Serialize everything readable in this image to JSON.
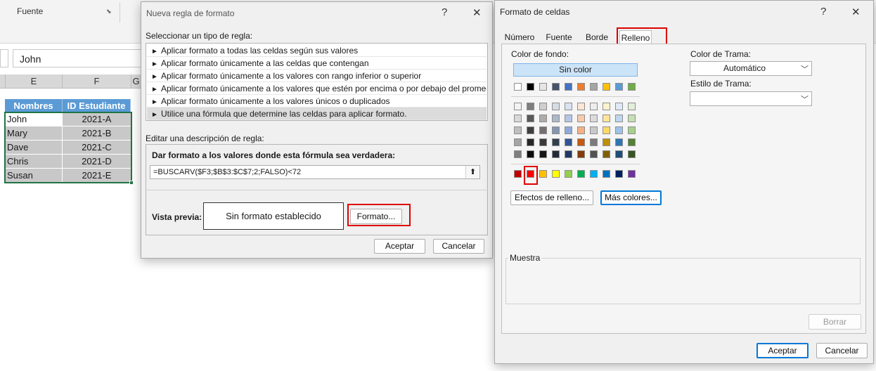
{
  "excel": {
    "ribbon_group": "Fuente",
    "formula_bar_value": "John",
    "columns": [
      "E",
      "F",
      "G"
    ],
    "table": {
      "headers": [
        "Nombres",
        "ID Estudiante"
      ],
      "rows": [
        {
          "name": "John",
          "id": "2021-A"
        },
        {
          "name": "Mary",
          "id": "2021-B"
        },
        {
          "name": "Dave",
          "id": "2021-C"
        },
        {
          "name": "Chris",
          "id": "2021-D"
        },
        {
          "name": "Susan",
          "id": "2021-E"
        }
      ]
    }
  },
  "rule_dialog": {
    "title": "Nueva regla de formato",
    "help": "?",
    "close": "✕",
    "select_label": "Seleccionar un tipo de regla:",
    "rule_types": [
      "Aplicar formato a todas las celdas según sus valores",
      "Aplicar formato únicamente a las celdas que contengan",
      "Aplicar formato únicamente a los valores con rango inferior o superior",
      "Aplicar formato únicamente a los valores que estén por encima o por debajo del promedio",
      "Aplicar formato únicamente a los valores únicos o duplicados",
      "Utilice una fórmula que determine las celdas para aplicar formato."
    ],
    "selected_rule_index": 5,
    "edit_label": "Editar una descripción de regla:",
    "formula_label": "Dar formato a los valores donde esta fórmula sea verdadera:",
    "formula": "=BUSCARV($F3;$B$3:$C$7;2;FALSO)<72",
    "preview_label": "Vista previa:",
    "preview_text": "Sin formato establecido",
    "format_button": "Formato...",
    "ok": "Aceptar",
    "cancel": "Cancelar"
  },
  "format_dialog": {
    "title": "Formato de celdas",
    "help": "?",
    "close": "✕",
    "tabs": [
      "Número",
      "Fuente",
      "Borde",
      "Relleno"
    ],
    "active_tab": "Relleno",
    "bg_color_label": "Color de fondo:",
    "no_color": "Sin color",
    "fill_effects": "Efectos de relleno...",
    "more_colors": "Más colores...",
    "pattern_color_label": "Color de Trama:",
    "pattern_color_value": "Automático",
    "pattern_style_label": "Estilo de Trama:",
    "pattern_style_value": "",
    "sample_label": "Muestra",
    "clear": "Borrar",
    "ok": "Aceptar",
    "cancel": "Cancelar",
    "palette_top": [
      "#ffffff",
      "#000000",
      "#e7e6e6",
      "#44546a",
      "#4472c4",
      "#ed7d31",
      "#a5a5a5",
      "#ffc000",
      "#5b9bd5",
      "#70ad47"
    ],
    "palette_shades": [
      [
        "#f2f2f2",
        "#7f7f7f",
        "#d0cece",
        "#d6dce4",
        "#d9e2f3",
        "#fbe5d5",
        "#ededed",
        "#fff2cc",
        "#deebf6",
        "#e2efd9"
      ],
      [
        "#d8d8d8",
        "#595959",
        "#aeabab",
        "#adb9ca",
        "#b4c6e7",
        "#f7caac",
        "#dbdbdb",
        "#fee599",
        "#bdd7ee",
        "#c5e0b3"
      ],
      [
        "#bfbfbf",
        "#3f3f3f",
        "#757070",
        "#8496b0",
        "#8eaadb",
        "#f4b183",
        "#c9c9c9",
        "#ffd965",
        "#9dc3e6",
        "#a8d08d"
      ],
      [
        "#a5a5a5",
        "#262626",
        "#3a3838",
        "#323f4f",
        "#2f5496",
        "#c55a11",
        "#7b7b7b",
        "#bf9000",
        "#2e75b5",
        "#538135"
      ],
      [
        "#7f7f7f",
        "#0c0c0c",
        "#171616",
        "#222a35",
        "#1f3864",
        "#833c0b",
        "#525252",
        "#7f6000",
        "#1e4e79",
        "#375623"
      ]
    ],
    "palette_standard": [
      "#c00000",
      "#ff0000",
      "#ffc000",
      "#ffff00",
      "#92d050",
      "#00b050",
      "#00b0f0",
      "#0070c0",
      "#002060",
      "#7030a0"
    ],
    "highlight_color": "#e00000"
  }
}
